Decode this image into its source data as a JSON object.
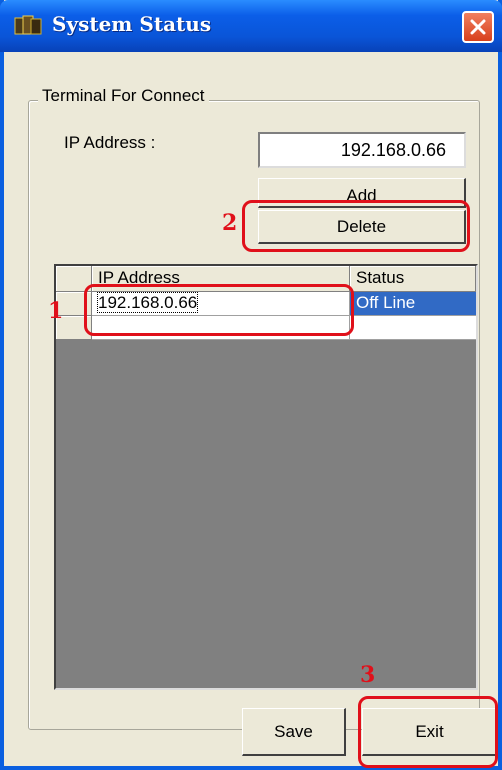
{
  "window": {
    "title": "System Status",
    "close_label": "×"
  },
  "group": {
    "legend": "Terminal For Connect"
  },
  "form": {
    "ip_label": "IP Address :",
    "ip_value": "192.168.0.66"
  },
  "buttons": {
    "add": "Add",
    "delete": "Delete",
    "save": "Save",
    "exit": "Exit"
  },
  "grid": {
    "headers": [
      "IP Address",
      "Status"
    ],
    "rows": [
      {
        "ip": "192.168.0.66",
        "status": "Off Line",
        "selected": true
      },
      {
        "ip": "",
        "status": "",
        "selected": false
      }
    ]
  },
  "annotations": {
    "n1": "1",
    "n2": "2",
    "n3": "3"
  },
  "colors": {
    "accent": "#0a5fe0",
    "selection": "#316ac5",
    "annotation": "#e0101a"
  },
  "icons": {
    "app": "app-icon",
    "close": "close-icon"
  }
}
